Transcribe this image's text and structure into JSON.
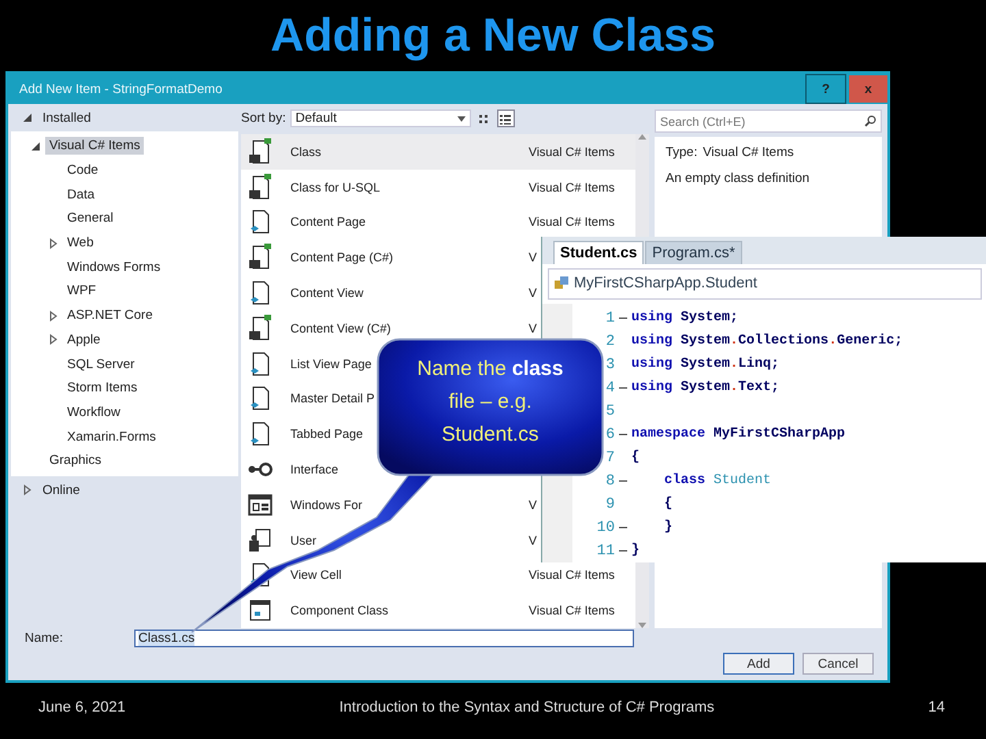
{
  "slide_title": "Adding a New Class",
  "dialog": {
    "title": "Add New Item - StringFormatDemo",
    "help_button": "?",
    "close_button": "x",
    "tree": [
      {
        "label": "Installed",
        "expanded": true,
        "children": [
          {
            "label": "Visual C# Items",
            "selected": true,
            "expanded": true,
            "children": [
              {
                "label": "Code",
                "selected": false
              },
              {
                "label": "Data",
                "selected": false
              },
              {
                "label": "General",
                "selected": false
              },
              {
                "label": "Web",
                "selected": false,
                "expanded": false
              },
              {
                "label": "Windows Forms",
                "selected": false
              },
              {
                "label": "WPF",
                "selected": false
              },
              {
                "label": "ASP.NET Core",
                "selected": false,
                "expanded": false
              },
              {
                "label": "Apple",
                "selected": false,
                "expanded": false
              },
              {
                "label": "SQL Server",
                "selected": false
              },
              {
                "label": "Storm Items",
                "selected": false
              },
              {
                "label": "Workflow",
                "selected": false
              },
              {
                "label": "Xamarin.Forms",
                "selected": false
              }
            ]
          },
          {
            "label": "Graphics",
            "selected": false
          }
        ]
      },
      {
        "label": "Online",
        "expanded": false
      }
    ],
    "sort_by": {
      "label": "Sort by:",
      "value": "Default"
    },
    "views": [
      {
        "kind": "grid",
        "selected": false
      },
      {
        "kind": "list",
        "selected": true
      }
    ],
    "templates": [
      {
        "name": "Class",
        "type": "Visual C# Items",
        "kind": "cs",
        "selected": true
      },
      {
        "name": "Class for U-SQL",
        "type": "Visual C# Items",
        "kind": "cs",
        "selected": false
      },
      {
        "name": "Content Page",
        "type": "Visual C# Items",
        "kind": "page",
        "selected": false
      },
      {
        "name": "Content Page (C#)",
        "type": "V",
        "kind": "cs",
        "selected": false
      },
      {
        "name": "Content View",
        "type": "V",
        "kind": "page",
        "selected": false
      },
      {
        "name": "Content View (C#)",
        "type": "V",
        "kind": "cs",
        "selected": false
      },
      {
        "name": "List View Page",
        "kind": "page",
        "selected": false
      },
      {
        "name": "Master Detail P",
        "kind": "page",
        "selected": false
      },
      {
        "name": "Tabbed Page",
        "kind": "page",
        "selected": false
      },
      {
        "name": "Interface",
        "kind": "interface",
        "selected": false
      },
      {
        "name": "Windows For",
        "type": "V",
        "kind": "form",
        "selected": false
      },
      {
        "name": "User",
        "type": "V",
        "kind": "control",
        "selected": false
      },
      {
        "name": "View Cell",
        "type": "Visual C# Items",
        "kind": "page",
        "selected": false
      },
      {
        "name": "Component Class",
        "type": "Visual C# Items",
        "kind": "component",
        "selected": false
      }
    ],
    "search": {
      "placeholder": "Search (Ctrl+E)"
    },
    "details": {
      "type_label": "Type:",
      "type_value": "Visual C# Items",
      "description": "An empty class definition"
    },
    "name_field": {
      "label": "Name:",
      "value": "Class1.cs"
    },
    "buttons": [
      "Add",
      "Cancel"
    ]
  },
  "code_window": {
    "tabs": [
      {
        "label": "Student.cs",
        "selected": true
      },
      {
        "label": "Program.cs*",
        "selected": false
      }
    ],
    "breadcrumb": "MyFirstCSharpApp.Student",
    "lines": [
      {
        "number": "1",
        "fold": true,
        "tokens": [
          {
            "text": "using ",
            "kind": "keyword"
          },
          {
            "text": "System;",
            "kind": "plain"
          }
        ]
      },
      {
        "number": "2",
        "fold": false,
        "tokens": [
          {
            "text": "using ",
            "kind": "keyword"
          },
          {
            "text": "System",
            "kind": "plain"
          },
          {
            "text": ".",
            "kind": "dot"
          },
          {
            "text": "Collections",
            "kind": "plain"
          },
          {
            "text": ".",
            "kind": "dot"
          },
          {
            "text": "Generic;",
            "kind": "plain"
          }
        ]
      },
      {
        "number": "3",
        "fold": false,
        "tokens": [
          {
            "text": "using ",
            "kind": "keyword"
          },
          {
            "text": "System",
            "kind": "plain"
          },
          {
            "text": ".",
            "kind": "dot"
          },
          {
            "text": "Linq;",
            "kind": "plain"
          }
        ]
      },
      {
        "number": "4",
        "fold": true,
        "tokens": [
          {
            "text": "using ",
            "kind": "keyword"
          },
          {
            "text": "System",
            "kind": "plain"
          },
          {
            "text": ".",
            "kind": "dot"
          },
          {
            "text": "Text;",
            "kind": "plain"
          }
        ]
      },
      {
        "number": "5",
        "fold": false
      },
      {
        "number": "6",
        "fold": true,
        "tokens": [
          {
            "text": "namespace ",
            "kind": "keyword"
          },
          {
            "text": "MyFirstCSharpApp",
            "kind": "plain"
          }
        ]
      },
      {
        "number": "7",
        "fold": false,
        "tokens": [
          {
            "text": "{",
            "kind": "plain"
          }
        ]
      },
      {
        "number": "8",
        "fold": true,
        "tokens": [
          {
            "text": "    class ",
            "kind": "keyword"
          },
          {
            "text": "Student",
            "kind": "type"
          }
        ]
      },
      {
        "number": "9",
        "fold": false,
        "tokens": [
          {
            "text": "    {",
            "kind": "plain"
          }
        ]
      },
      {
        "number": "10",
        "fold": true,
        "tokens": [
          {
            "text": "    }",
            "kind": "plain"
          }
        ]
      },
      {
        "number": "11",
        "fold": true,
        "tokens": [
          {
            "text": "}",
            "kind": "plain"
          }
        ]
      }
    ]
  },
  "callout": {
    "text": "Name the **class** file – e.g. Student.cs"
  },
  "footer": {
    "date": "June 6, 2021",
    "title": "Introduction to the Syntax and Structure of C# Programs",
    "page": "14"
  }
}
